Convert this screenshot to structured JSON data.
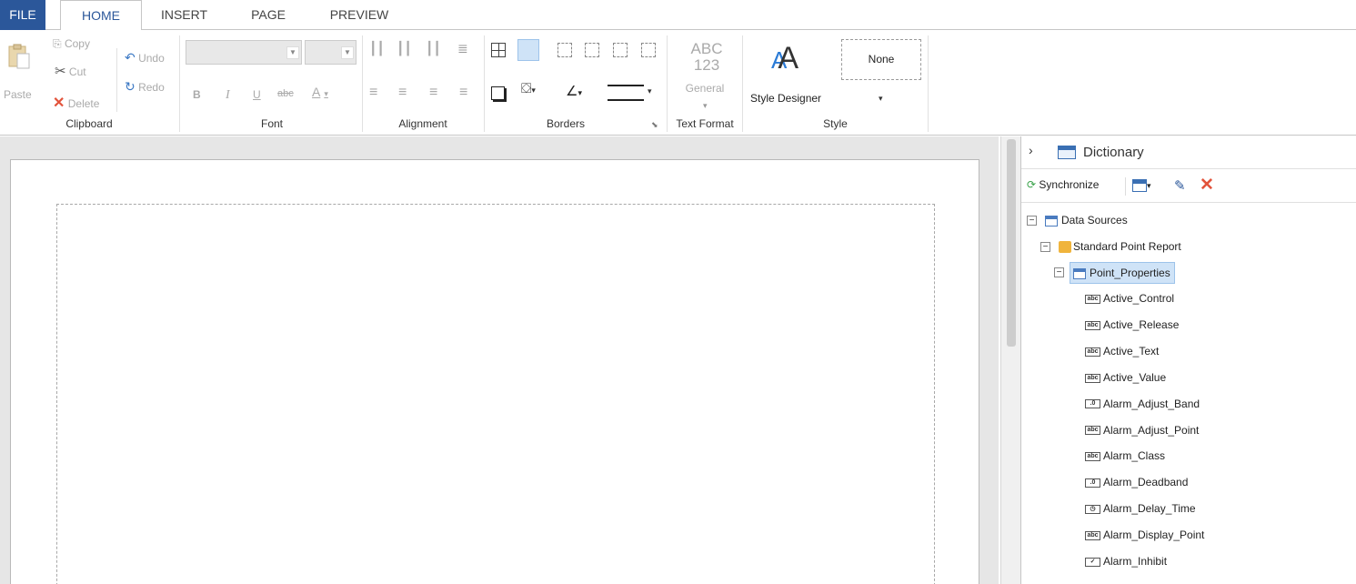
{
  "tabs": {
    "file": "FILE",
    "home": "HOME",
    "insert": "INSERT",
    "page": "PAGE",
    "preview": "PREVIEW"
  },
  "clipboard": {
    "paste": "Paste",
    "copy": "Copy",
    "cut": "Cut",
    "delete": "Delete",
    "undo": "Undo",
    "redo": "Redo",
    "label": "Clipboard"
  },
  "font": {
    "bold": "B",
    "italic": "I",
    "underline": "U",
    "strike": "abc",
    "color": "A",
    "label": "Font"
  },
  "alignment": {
    "label": "Alignment"
  },
  "borders": {
    "label": "Borders"
  },
  "text_format": {
    "abc": "ABC",
    "num": "123",
    "general": "General",
    "label": "Text Format"
  },
  "style": {
    "designer": "Style Designer",
    "none": "None",
    "label": "Style"
  },
  "dictionary": {
    "title": "Dictionary",
    "synchronize": "Synchronize",
    "tree": {
      "data_sources": "Data Sources",
      "report": "Standard Point Report",
      "table": "Point_Properties",
      "fields": [
        {
          "name": "Active_Control",
          "icon": "abc"
        },
        {
          "name": "Active_Release",
          "icon": "abc"
        },
        {
          "name": "Active_Text",
          "icon": "abc"
        },
        {
          "name": "Active_Value",
          "icon": "abc"
        },
        {
          "name": "Alarm_Adjust_Band",
          "icon": "num"
        },
        {
          "name": "Alarm_Adjust_Point",
          "icon": "abc"
        },
        {
          "name": "Alarm_Class",
          "icon": "abc"
        },
        {
          "name": "Alarm_Deadband",
          "icon": "num"
        },
        {
          "name": "Alarm_Delay_Time",
          "icon": "time"
        },
        {
          "name": "Alarm_Display_Point",
          "icon": "abc"
        },
        {
          "name": "Alarm_Inhibit",
          "icon": "bool"
        }
      ]
    }
  },
  "colors": {
    "accent": "#2b579a",
    "delete": "#e2533b",
    "selected": "#cfe3f7"
  }
}
